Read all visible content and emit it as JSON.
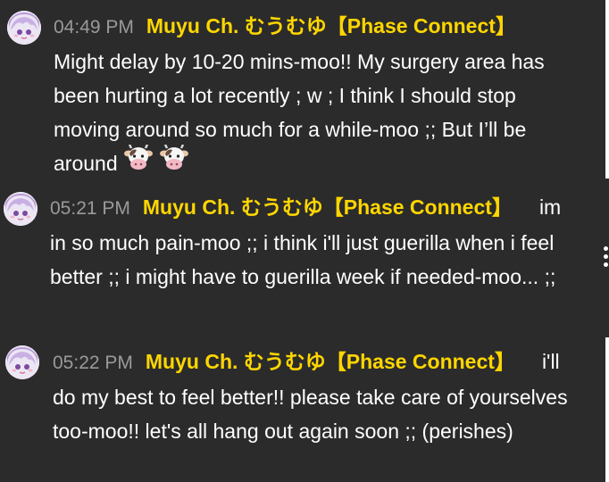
{
  "messages": [
    {
      "time": "04:49 PM",
      "author": "Muyu Ch. むうむゆ【Phase Connect】",
      "text": "Might delay by 10-20 mins-moo!! My surgery area has been hurting a lot recently ; w ; I think I should stop moving around so much for a while-moo ;; But I’ll be around",
      "emoji_count": 2
    },
    {
      "time": "05:21 PM",
      "author": "Muyu Ch. むうむゆ【Phase Connect】",
      "text": "im in so much pain-moo ;; i think i'll just guerilla when i feel better ;; i might have to guerilla week if needed-moo... ;;"
    },
    {
      "time": "05:22 PM",
      "author": "Muyu Ch. むうむゆ【Phase Connect】",
      "text": "i'll do my best to feel better!! please take care of yourselves too-moo!! let's all hang out again soon ;; (perishes)"
    }
  ],
  "icons": {
    "avatar": "muyu-avatar-icon",
    "emoji": "cow-face-icon",
    "more": "more-vertical-icon"
  },
  "colors": {
    "background": "#2b2b2b",
    "author": "#ffd600",
    "timestamp": "#9a9a9a",
    "text": "#ffffff"
  }
}
